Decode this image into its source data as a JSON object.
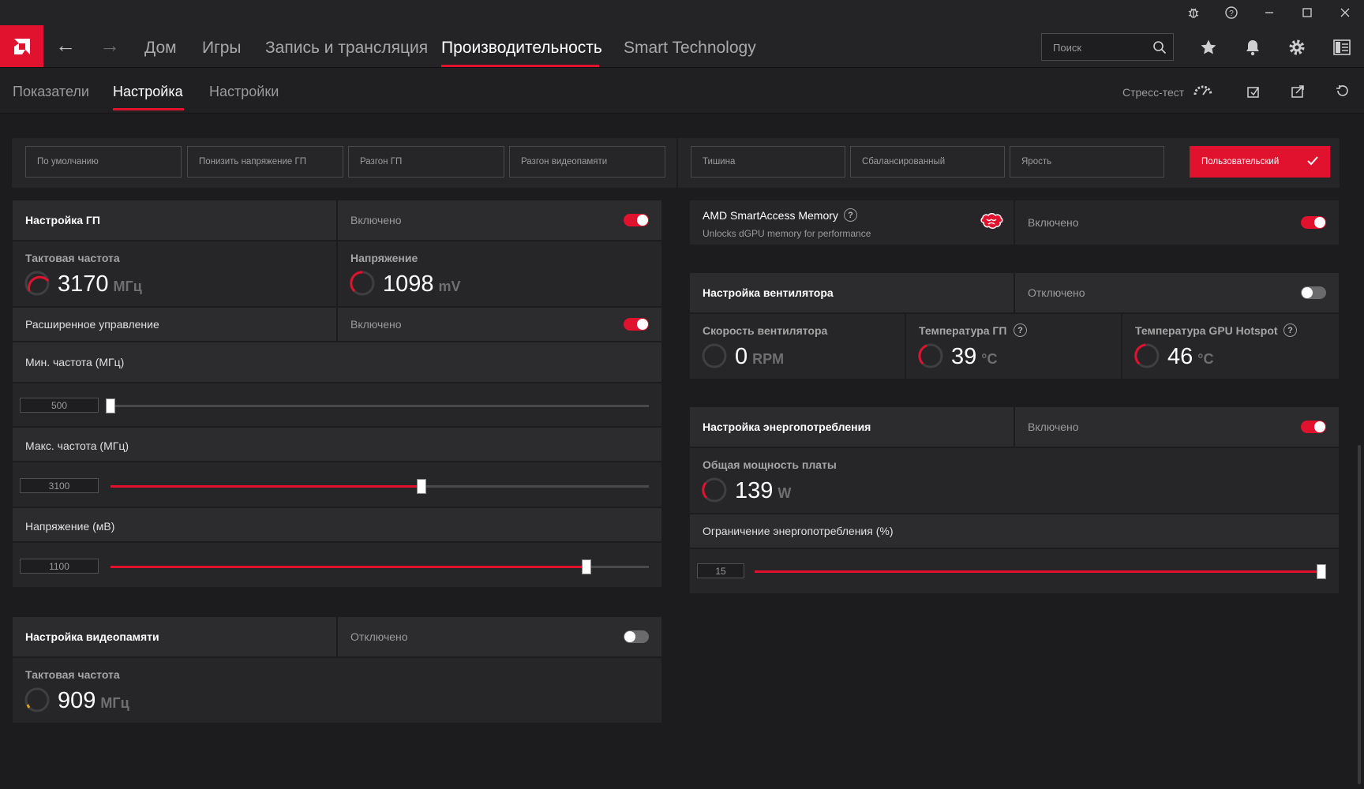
{
  "titlebar": {
    "icons": [
      "bug-icon",
      "help-icon",
      "minimize-icon",
      "maximize-icon",
      "close-icon"
    ]
  },
  "nav": {
    "items": [
      "Дом",
      "Игры",
      "Запись и трансляция",
      "Производительность",
      "Smart Technology"
    ],
    "active": "Производительность",
    "search_placeholder": "Поиск"
  },
  "subnav": {
    "items": [
      "Показатели",
      "Настройка",
      "Настройки"
    ],
    "active": "Настройка",
    "stress_test": "Стресс-тест"
  },
  "presets": {
    "left": [
      "По умолчанию",
      "Понизить напряжение ГП",
      "Разгон ГП",
      "Разгон видеопамяти"
    ],
    "right": [
      "Тишина",
      "Сбалансированный",
      "Ярость"
    ],
    "active": "Пользовательский"
  },
  "gpu": {
    "title": "Настройка ГП",
    "state": "Включено",
    "enabled": true,
    "clock_label": "Тактовая частота",
    "clock_value": "3170",
    "clock_unit": "МГц",
    "voltage_label": "Напряжение",
    "voltage_value": "1098",
    "voltage_unit": "mV",
    "advanced_label": "Расширенное управление",
    "advanced_state": "Включено",
    "advanced_enabled": true,
    "min_label": "Мин. частота (МГц)",
    "min_value": "500",
    "min_fraction": 0.0,
    "max_label": "Макс. частота (МГц)",
    "max_value": "3100",
    "max_fraction": 0.578,
    "volt_slider_label": "Напряжение (мВ)",
    "volt_slider_value": "1100",
    "volt_fraction": 0.884
  },
  "vram": {
    "title": "Настройка видеопамяти",
    "state": "Отключено",
    "enabled": false,
    "clock_label": "Тактовая частота",
    "clock_value": "909",
    "clock_unit": "МГц"
  },
  "sam": {
    "title": "AMD SmartAccess Memory",
    "subtitle": "Unlocks dGPU memory for performance",
    "state": "Включено",
    "enabled": true
  },
  "fan": {
    "title": "Настройка вентилятора",
    "state": "Отключено",
    "enabled": false,
    "speed_label": "Скорость вентилятора",
    "speed_value": "0",
    "speed_unit": "RPM",
    "temp_label": "Температура ГП",
    "temp_value": "39",
    "temp_unit": "°C",
    "hotspot_label": "Температура GPU Hotspot",
    "hotspot_value": "46",
    "hotspot_unit": "°C"
  },
  "power": {
    "title": "Настройка энергопотребления",
    "state": "Включено",
    "enabled": true,
    "board_label": "Общая мощность платы",
    "board_value": "139",
    "board_unit": "W",
    "limit_label": "Ограничение энергопотребления (%)",
    "limit_value": "15",
    "limit_fraction": 1.0
  },
  "colors": {
    "accent": "#e0122e",
    "background": "#1c1c1e",
    "panel": "#262628"
  }
}
